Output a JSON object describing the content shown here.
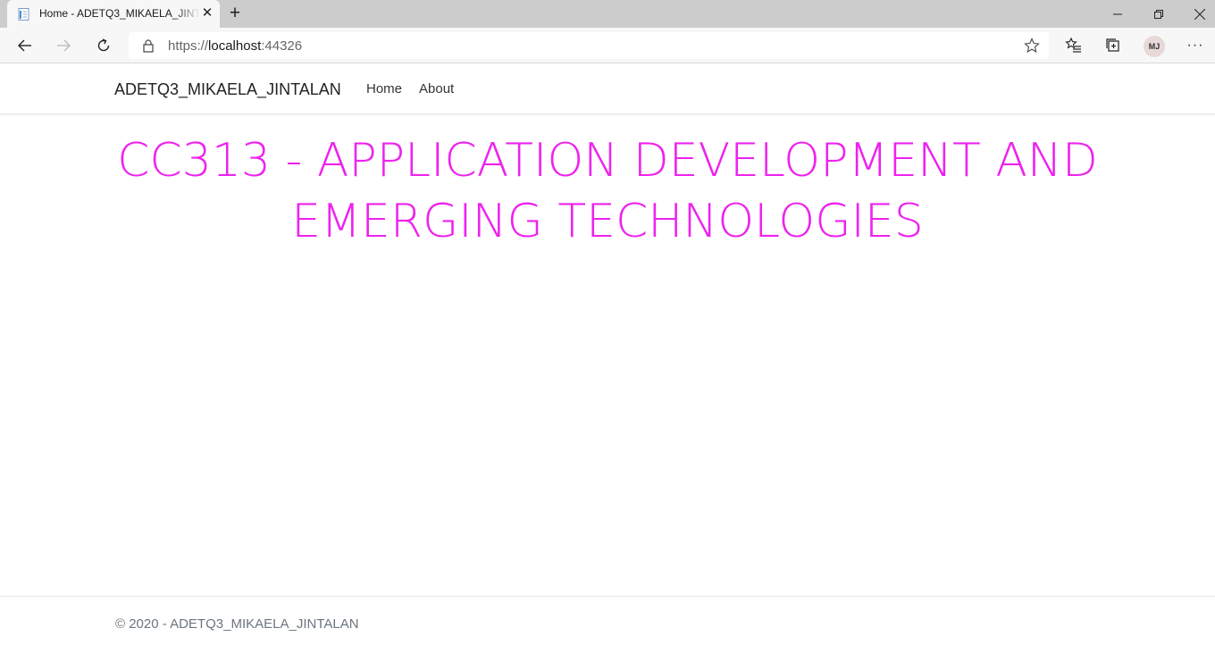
{
  "browser": {
    "tab_title": "Home - ADETQ3_MIKAELA_JINTALAN",
    "url_scheme": "https://",
    "url_host": "localhost",
    "url_port": ":44326",
    "profile_initials": "MJ",
    "icons": {
      "favicon": "page-icon",
      "close": "close-icon",
      "new_tab": "plus-icon",
      "back": "arrow-left-icon",
      "forward": "arrow-right-icon",
      "refresh": "refresh-icon",
      "lock": "lock-icon",
      "star": "star-icon",
      "favorites": "favorites-icon",
      "collections": "collections-icon",
      "more": "more-icon"
    }
  },
  "site": {
    "brand": "ADETQ3_MIKAELA_JINTALAN",
    "nav": [
      {
        "label": "Home"
      },
      {
        "label": "About"
      }
    ],
    "hero": {
      "line1": "CC313 - APPLICATION DEVELOPMENT AND",
      "line2": "EMERGING TECHNOLOGIES",
      "color": "#EE22EE"
    },
    "footer": "© 2020 - ADETQ3_MIKAELA_JINTALAN"
  }
}
